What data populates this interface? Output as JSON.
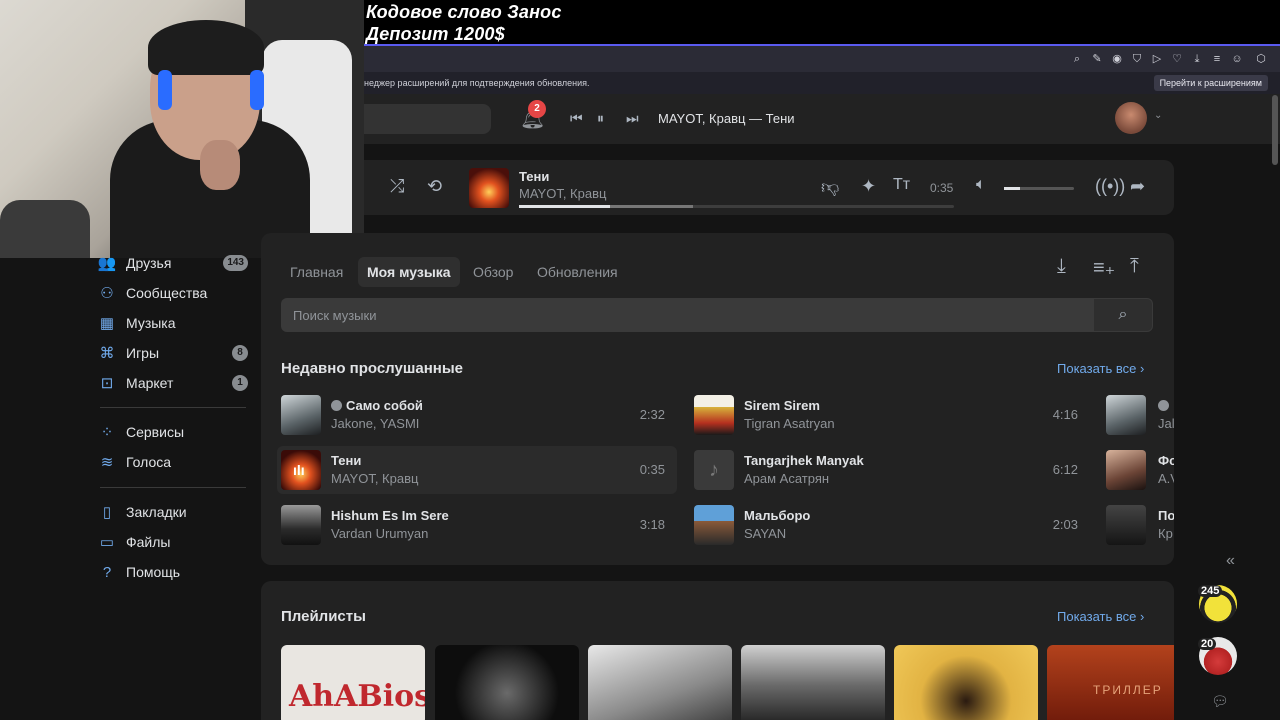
{
  "overlay": {
    "line1": "Кодовое слово Занос",
    "line2": "Депозит 1200$"
  },
  "browser": {
    "extension_message": "неджер расширений для подтверждения обновления.",
    "extension_button": "Перейти к расширениям"
  },
  "header": {
    "notifications_count": "2",
    "now_playing": "MAYOT, Кравц — Тени"
  },
  "sidebar": {
    "items": [
      {
        "label": "Друзья",
        "icon": "friends-icon",
        "glyph": "👥",
        "badge": "143"
      },
      {
        "label": "Сообщества",
        "icon": "communities-icon",
        "glyph": "⚇",
        "badge": ""
      },
      {
        "label": "Музыка",
        "icon": "music-icon",
        "glyph": "▦",
        "badge": ""
      },
      {
        "label": "Игры",
        "icon": "games-icon",
        "glyph": "⌘",
        "badge": "8"
      },
      {
        "label": "Маркет",
        "icon": "market-icon",
        "glyph": "⊡",
        "badge": "1"
      },
      {
        "label": "Сервисы",
        "icon": "services-icon",
        "glyph": "⁘",
        "badge": ""
      },
      {
        "label": "Голоса",
        "icon": "votes-icon",
        "glyph": "≋",
        "badge": ""
      },
      {
        "label": "Закладки",
        "icon": "bookmarks-icon",
        "glyph": "▯",
        "badge": ""
      },
      {
        "label": "Файлы",
        "icon": "files-icon",
        "glyph": "▭",
        "badge": ""
      },
      {
        "label": "Помощь",
        "icon": "help-icon",
        "glyph": "?",
        "badge": ""
      }
    ]
  },
  "player": {
    "title": "Тени",
    "artist": "MAYOT, Кравц",
    "time": "0:35",
    "progress": 0.21,
    "buffered": 0.4,
    "volume": 0.23
  },
  "music": {
    "tabs": [
      "Главная",
      "Моя музыка",
      "Обзор",
      "Обновления"
    ],
    "active_tab": "Моя музыка",
    "search_placeholder": "Поиск музыки",
    "recent_title": "Недавно прослушанные",
    "show_all": "Показать все",
    "tracks_left": [
      {
        "title": "Само собой",
        "artist": "Jakone, YASMI",
        "duration": "2:32",
        "explicit": true
      },
      {
        "title": "Тени",
        "artist": "MAYOT, Кравц",
        "duration": "0:35",
        "explicit": false
      },
      {
        "title": "Hishum Es Im Sere",
        "artist": "Vardan Urumyan",
        "duration": "3:18",
        "explicit": false
      }
    ],
    "tracks_mid": [
      {
        "title": "Sirem Sirem",
        "artist": "Tigran Asatryan",
        "duration": "4:16"
      },
      {
        "title": "Tangarjhek Manyak",
        "artist": "Арам Асатрян",
        "duration": "6:12"
      },
      {
        "title": "Мальборо",
        "artist": "SAYAN",
        "duration": "2:03"
      }
    ],
    "tracks_right_partial": [
      {
        "title": "",
        "artist": "Jal"
      },
      {
        "title": "Фо",
        "artist": "A.V"
      },
      {
        "title": "По",
        "artist": "Кр"
      }
    ],
    "playlists_title": "Плейлисты",
    "playlists_show_all": "Показать все",
    "playlist_thumb_text_1": "AhABios",
    "playlist_thumb_text_6": "ТРИЛЛЕР"
  },
  "rail": {
    "count1": "245",
    "count2": "20"
  },
  "colors": {
    "accent": "#71aaeb",
    "badge_red": "#e64646",
    "bg": "#141414",
    "card": "#222222"
  }
}
